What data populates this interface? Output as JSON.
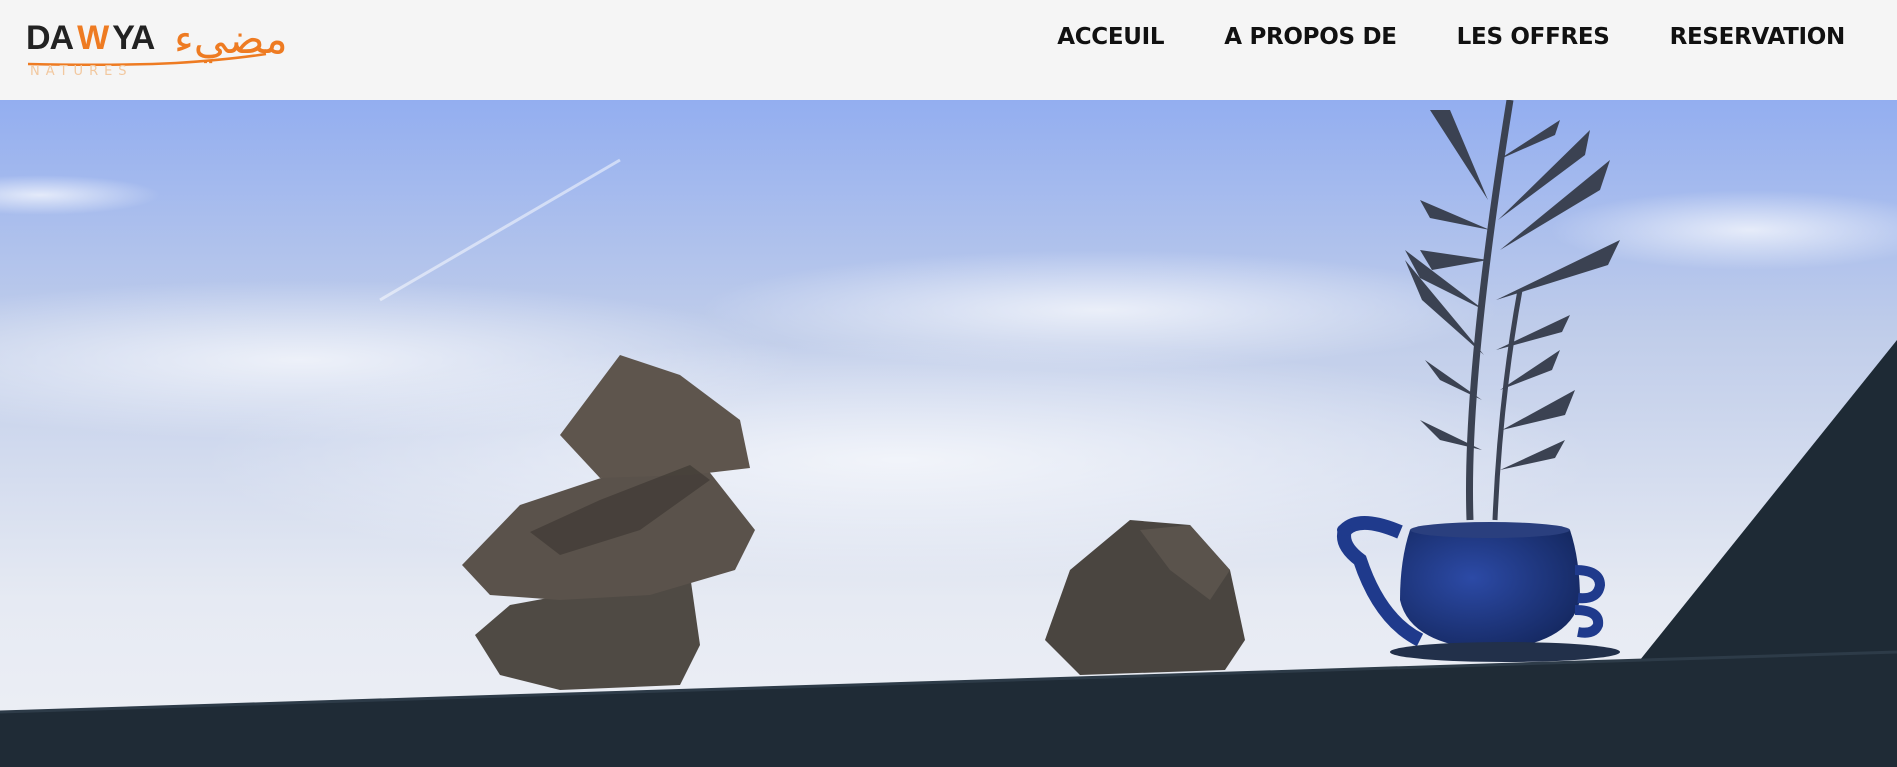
{
  "logo": {
    "latin_left": "DA",
    "latin_w": "W",
    "latin_right": "YA",
    "arabic": "مضيء",
    "subtitle": "NATURES"
  },
  "nav": {
    "items": [
      {
        "label": "ACCEUIL"
      },
      {
        "label": "A PROPOS DE"
      },
      {
        "label": "LES OFFRES"
      },
      {
        "label": "RESERVATION"
      }
    ]
  },
  "colors": {
    "accent": "#ee7b22",
    "header_bg": "#f5f5f5",
    "nav_text": "#111111",
    "sky_top": "#93aef0",
    "sky_bottom": "#e9edf6",
    "wall": "#1f2b36",
    "teapot": "#1f3a8c"
  },
  "hero": {
    "icons": [
      "stacked-rocks",
      "single-rock",
      "teapot-planter",
      "plant"
    ]
  }
}
